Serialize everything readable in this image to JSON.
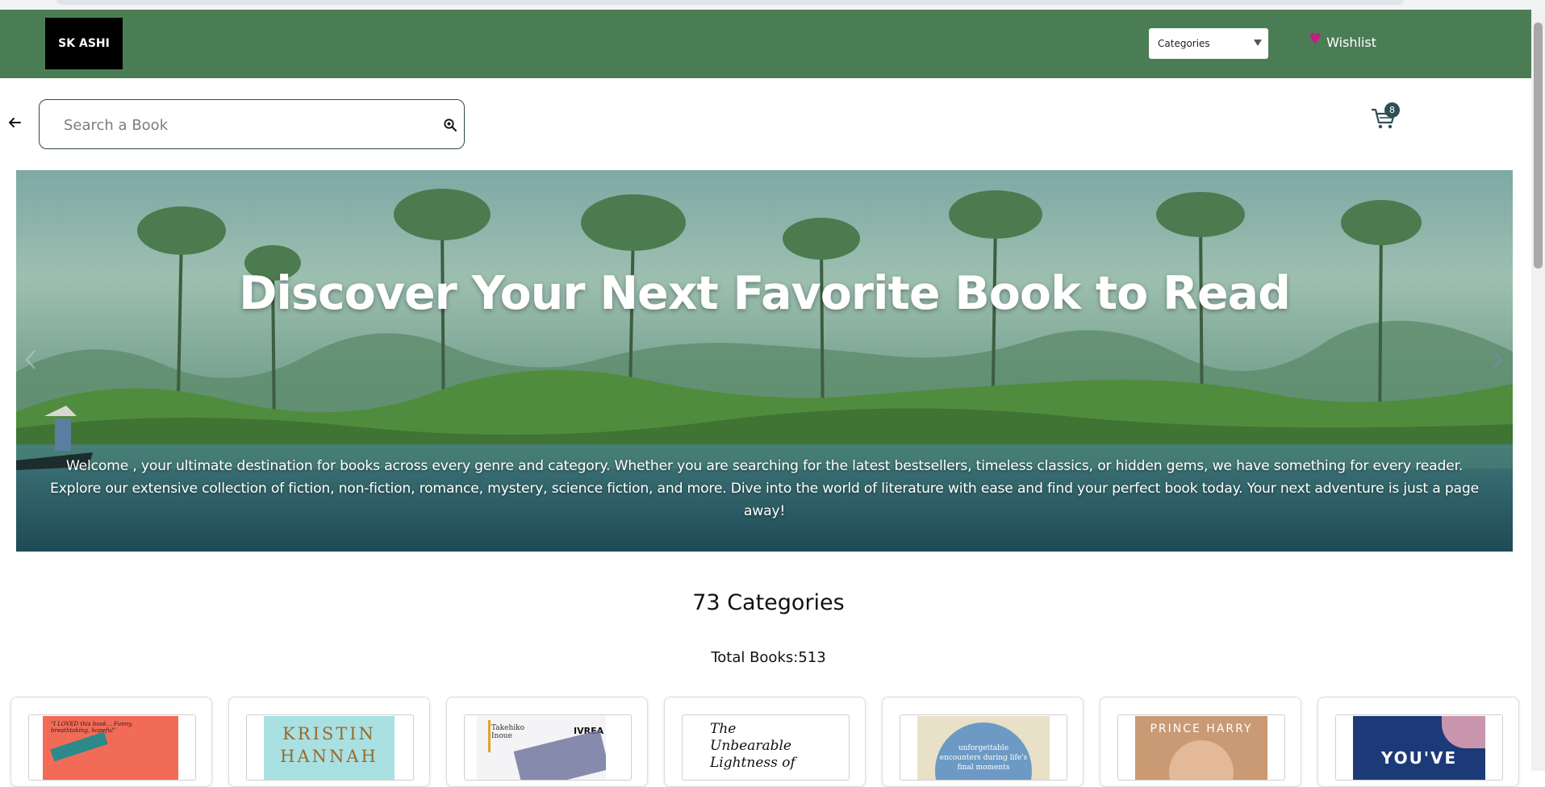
{
  "header": {
    "logo_text": "SK ASHI",
    "categories_select": "Categories",
    "wishlist_label": "Wishlist",
    "brand_color": "#4b7d55"
  },
  "search": {
    "placeholder": "Search a Book",
    "value": "",
    "icon": "search-icon"
  },
  "cart": {
    "icon": "cart-icon",
    "count": "8"
  },
  "hero": {
    "title": "Discover Your Next Favorite Book to Read",
    "description": "Welcome , your ultimate destination for books across every genre and category. Whether you are searching for the latest bestsellers, timeless classics, or hidden gems, we have something for every reader. Explore our extensive collection of fiction, non-fiction, romance, mystery, science fiction, and more. Dive into the world of literature with ease and find your perfect book today. Your next adventure is just a page away!"
  },
  "stats": {
    "categories": "73 Categories",
    "total_books": "Total Books:513"
  },
  "books": [
    {
      "cover_text": "\"I LOVED this book... Funny, breathtaking, hopeful\"",
      "cover_color": "#f26b57"
    },
    {
      "cover_text": "KRISTIN HANNAH",
      "cover_color": "#a9e0e2"
    },
    {
      "cover_text": "Takehiko Inoue",
      "cover_text2": "IVREA",
      "cover_color": "#f4f4f6"
    },
    {
      "cover_text": "The Unbearable Lightness of",
      "cover_color": "#ffffff"
    },
    {
      "cover_text": "unforgettable encounters during life's final moments",
      "cover_color": "#e9e0c8"
    },
    {
      "cover_text": "PRINCE HARRY",
      "cover_color": "#c99a74"
    },
    {
      "cover_text": "YOU'VE",
      "cover_color": "#1d3a78"
    }
  ]
}
